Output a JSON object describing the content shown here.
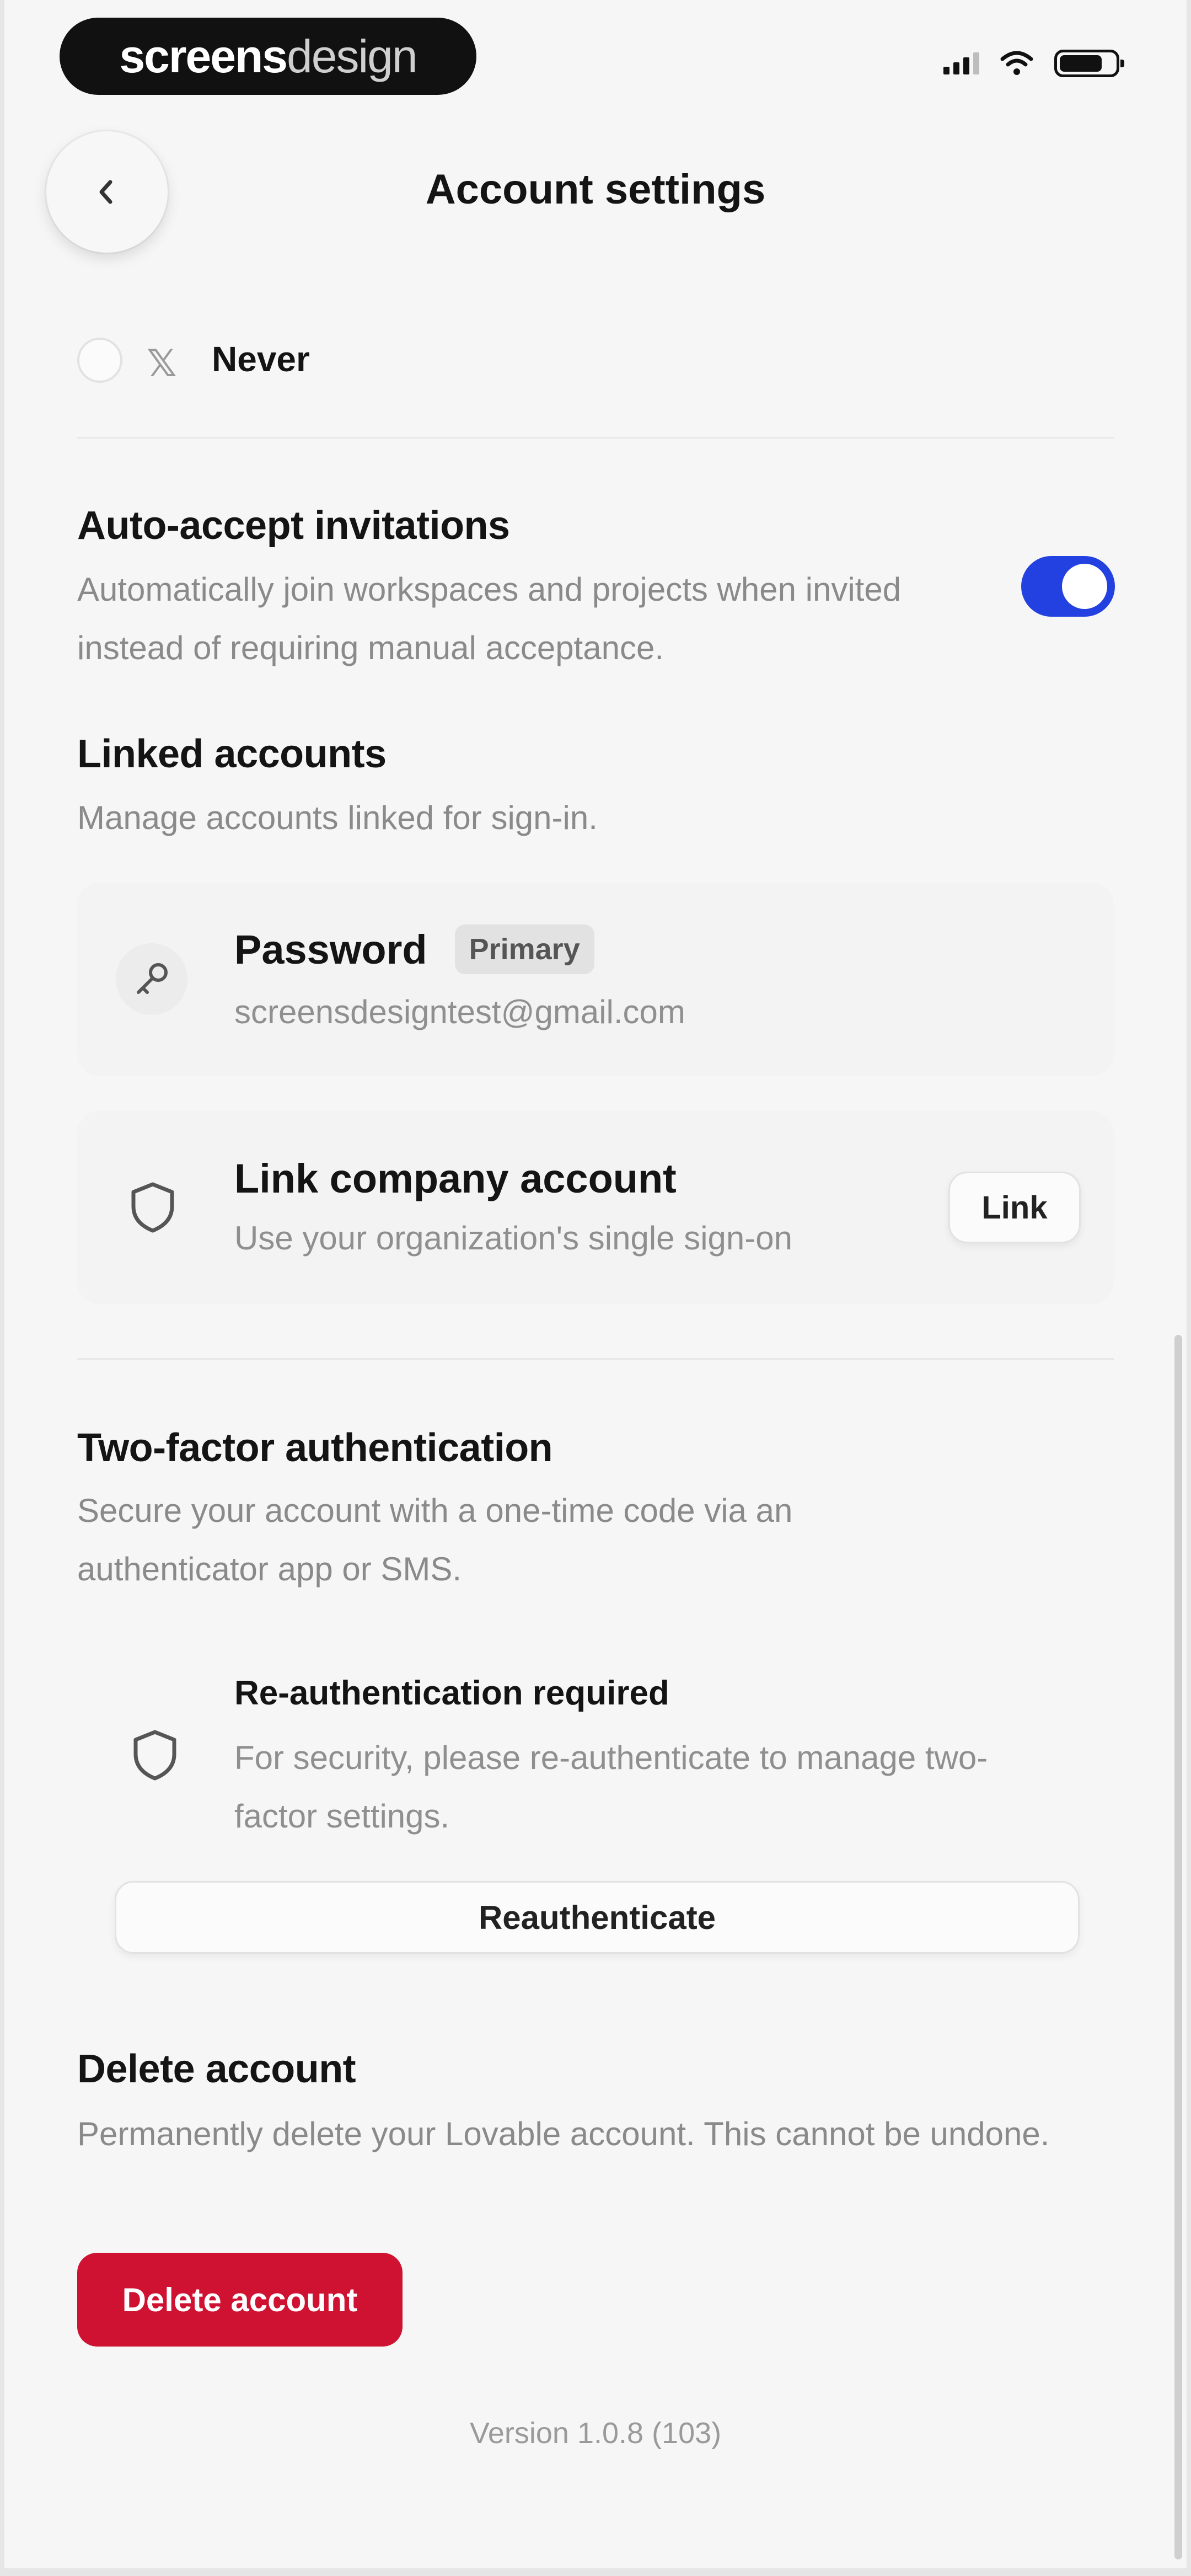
{
  "status_bar": {
    "brand_bold": "screens",
    "brand_light": "design"
  },
  "header": {
    "title": "Account settings"
  },
  "never_option": {
    "label": "Never"
  },
  "auto_accept": {
    "title": "Auto-accept invitations",
    "description": "Automatically join workspaces and projects when invited instead of requiring manual acceptance.",
    "enabled": true
  },
  "linked_accounts": {
    "title": "Linked accounts",
    "description": "Manage accounts linked for sign-in.",
    "password": {
      "title": "Password",
      "badge": "Primary",
      "email": "screensdesigntest@gmail.com"
    },
    "company": {
      "title": "Link company account",
      "subtitle": "Use your organization's single sign-on",
      "button": "Link"
    }
  },
  "two_factor": {
    "title": "Two-factor authentication",
    "description": "Secure your account with a one-time code via an authenticator app or SMS.",
    "reauth_title": "Re-authentication required",
    "reauth_text": "For security, please re-authenticate to manage two-factor settings.",
    "button": "Reauthenticate"
  },
  "delete_account": {
    "title": "Delete account",
    "description": "Permanently delete your Lovable account. This cannot be undone.",
    "button": "Delete account"
  },
  "footer": {
    "version": "Version 1.0.8 (103)"
  },
  "colors": {
    "accent": "#2340e0",
    "danger": "#cf1232",
    "background": "#f6f6f6"
  }
}
